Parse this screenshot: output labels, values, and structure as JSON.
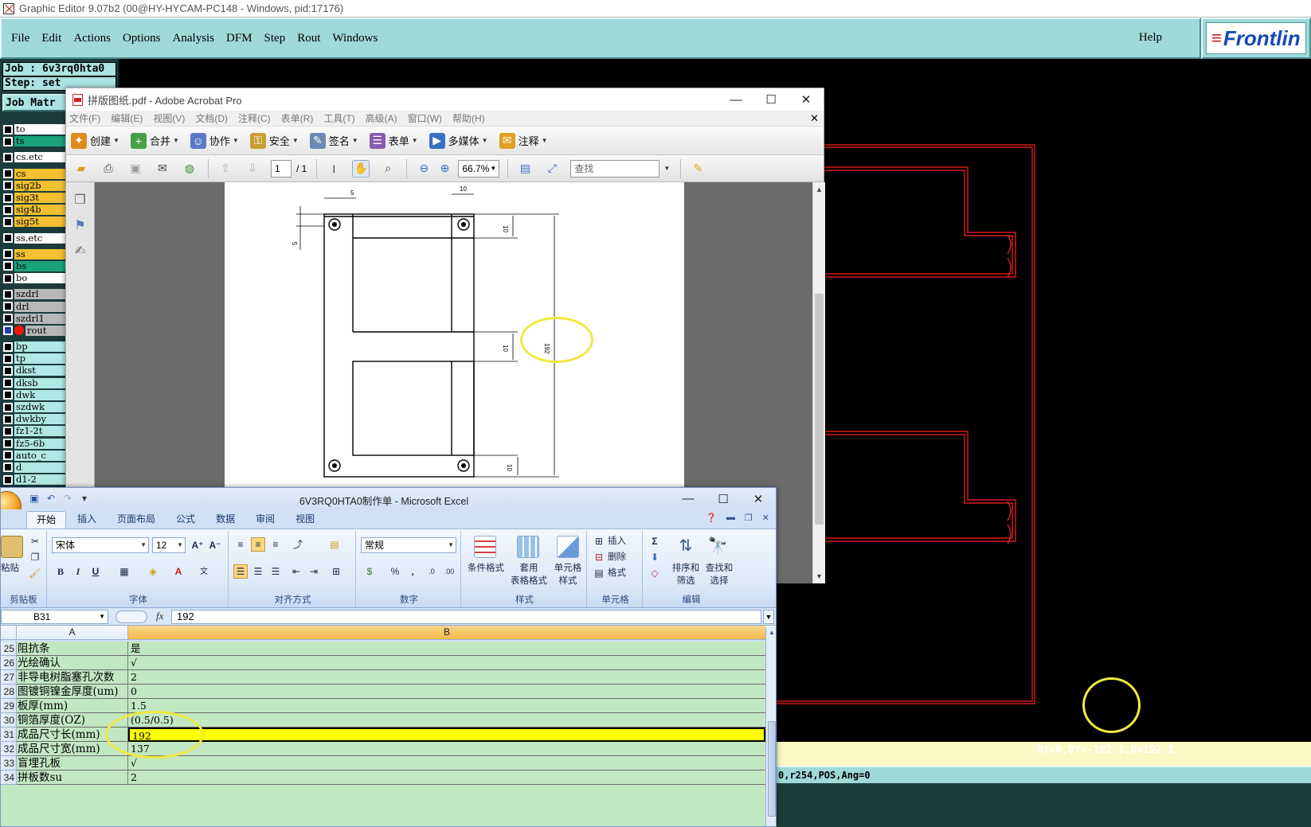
{
  "graphic_editor": {
    "title": "Graphic Editor 9.07b2 (00@HY-HYCAM-PC148 - Windows, pid:17176)",
    "menu": [
      "File",
      "Edit",
      "Actions",
      "Options",
      "Analysis",
      "DFM",
      "Step",
      "Rout",
      "Windows"
    ],
    "help": "Help",
    "logo_text": "Frontlin",
    "job": "Job : 6v3rq0hta0",
    "step": "Step: set",
    "job_matrix": "Job Matr",
    "layers": [
      {
        "name": "to",
        "cls": "ln-board",
        "gap": true,
        "on": false,
        "dot": false
      },
      {
        "name": "ts",
        "cls": "ln-sm",
        "gap": false,
        "on": false,
        "dot": false
      },
      {
        "name": "cs.etc",
        "cls": "ln-board",
        "gap": true,
        "on": false,
        "dot": false
      },
      {
        "name": "cs",
        "cls": "ln-sig",
        "gap": true,
        "on": false,
        "dot": false
      },
      {
        "name": "sig2b",
        "cls": "ln-sig",
        "gap": false,
        "on": false,
        "dot": false
      },
      {
        "name": "sig3t",
        "cls": "ln-sig",
        "gap": false,
        "on": false,
        "dot": false
      },
      {
        "name": "sig4b",
        "cls": "ln-sig",
        "gap": false,
        "on": false,
        "dot": false
      },
      {
        "name": "sig5t",
        "cls": "ln-sig",
        "gap": false,
        "on": false,
        "dot": false
      },
      {
        "name": "ss.etc",
        "cls": "ln-board",
        "gap": true,
        "on": false,
        "dot": false
      },
      {
        "name": "ss",
        "cls": "ln-sig",
        "gap": true,
        "on": false,
        "dot": false
      },
      {
        "name": "bs",
        "cls": "ln-sm",
        "gap": false,
        "on": false,
        "dot": false
      },
      {
        "name": "bo",
        "cls": "ln-board",
        "gap": false,
        "on": false,
        "dot": false
      },
      {
        "name": "szdrl",
        "cls": "ln-drill",
        "gap": true,
        "on": false,
        "dot": false
      },
      {
        "name": "drl",
        "cls": "ln-drill",
        "gap": false,
        "on": false,
        "dot": false
      },
      {
        "name": "szdrl1",
        "cls": "ln-drill",
        "gap": false,
        "on": false,
        "dot": false
      },
      {
        "name": "rout",
        "cls": "ln-drill",
        "gap": false,
        "on": true,
        "dot": true
      },
      {
        "name": "bp",
        "cls": "ln-misc",
        "gap": true,
        "on": false,
        "dot": false
      },
      {
        "name": "tp",
        "cls": "ln-misc",
        "gap": false,
        "on": false,
        "dot": false
      },
      {
        "name": "dkst",
        "cls": "ln-misc",
        "gap": false,
        "on": false,
        "dot": false
      },
      {
        "name": "dksb",
        "cls": "ln-misc",
        "gap": false,
        "on": false,
        "dot": false
      },
      {
        "name": "dwk",
        "cls": "ln-misc",
        "gap": false,
        "on": false,
        "dot": false
      },
      {
        "name": "szdwk",
        "cls": "ln-misc",
        "gap": false,
        "on": false,
        "dot": false
      },
      {
        "name": "dwkby",
        "cls": "ln-misc",
        "gap": false,
        "on": false,
        "dot": false
      },
      {
        "name": "fz1-2t",
        "cls": "ln-misc",
        "gap": false,
        "on": false,
        "dot": false
      },
      {
        "name": "fz5-6b",
        "cls": "ln-misc",
        "gap": false,
        "on": false,
        "dot": false
      },
      {
        "name": "auto_c",
        "cls": "ln-misc",
        "gap": false,
        "on": false,
        "dot": false
      },
      {
        "name": "d",
        "cls": "ln-misc",
        "gap": false,
        "on": false,
        "dot": false
      },
      {
        "name": "d1-2",
        "cls": "ln-misc",
        "gap": false,
        "on": false,
        "dot": false
      }
    ],
    "measure_text": "DX=0,DY=-192.1,D=192.1",
    "coord_text": "0,r254,POS,Ang=0",
    "colors": {
      "outline": "#ff2020",
      "background": "#000000",
      "panel": "#9fd9d8",
      "highlight": "#eeea40"
    }
  },
  "acrobat": {
    "title": "拼版图纸.pdf - Adobe Acrobat Pro",
    "menu": [
      "文件(F)",
      "编辑(E)",
      "视图(V)",
      "文档(D)",
      "注释(C)",
      "表单(R)",
      "工具(T)",
      "高级(A)",
      "窗口(W)",
      "帮助(H)"
    ],
    "tools": [
      {
        "label": "创建",
        "color": "#e08a20",
        "glyph": "✦"
      },
      {
        "label": "合并",
        "color": "#48a048",
        "glyph": "+"
      },
      {
        "label": "协作",
        "color": "#5a7ac8",
        "glyph": "☺"
      },
      {
        "label": "安全",
        "color": "#c8a030",
        "glyph": "⚿"
      },
      {
        "label": "签名",
        "color": "#6a8ab0",
        "glyph": "✎"
      },
      {
        "label": "表单",
        "color": "#8a5ab0",
        "glyph": "☰"
      },
      {
        "label": "多媒体",
        "color": "#3a70c0",
        "glyph": "▶"
      },
      {
        "label": "注释",
        "color": "#e0a020",
        "glyph": "✉"
      }
    ],
    "page_current": "1",
    "page_total": "/ 1",
    "zoom": "66.7%",
    "find_placeholder": "查找",
    "dim_labels": {
      "top": "5",
      "top_right": "10",
      "left": "5",
      "r1": "10",
      "r2": "10",
      "r3": "10",
      "overall": "192"
    }
  },
  "excel": {
    "title": "6V3RQ0HTA0制作单 - Microsoft Excel",
    "tabs": [
      "开始",
      "插入",
      "页面布局",
      "公式",
      "数据",
      "审阅",
      "视图"
    ],
    "ribbon": {
      "clipboard": {
        "paste": "粘贴",
        "label": "剪贴板"
      },
      "font": {
        "name": "宋体",
        "size": "12",
        "bold": "B",
        "italic": "I",
        "underline": "U",
        "label": "字体"
      },
      "alignment": {
        "label": "对齐方式"
      },
      "number": {
        "format": "常规",
        "label": "数字"
      },
      "styles": {
        "cond": "条件格式",
        "table1": "套用",
        "table2": "表格格式",
        "cell1": "单元格",
        "cell2": "样式",
        "label": "样式"
      },
      "cells": {
        "insert": "插入",
        "delete": "删除",
        "format": "格式",
        "label": "单元格"
      },
      "editing": {
        "sort1": "排序和",
        "sort2": "筛选",
        "find1": "查找和",
        "find2": "选择",
        "label": "编辑"
      }
    },
    "name_box": "B31",
    "formula_value": "192",
    "columns": [
      "A",
      "B"
    ],
    "rows": [
      {
        "num": "25",
        "a": "阻抗条",
        "b": "是",
        "selected": false
      },
      {
        "num": "26",
        "a": "光绘确认",
        "b": "√",
        "selected": false
      },
      {
        "num": "27",
        "a": "非导电树脂塞孔次数",
        "b": "2",
        "selected": false
      },
      {
        "num": "28",
        "a": "图镀铜镍金厚度(um)",
        "b": "0",
        "selected": false
      },
      {
        "num": "29",
        "a": "板厚(mm)",
        "b": "1.5",
        "selected": false
      },
      {
        "num": "30",
        "a": "铜箔厚度(OZ)",
        "b": "(0.5/0.5)",
        "selected": false
      },
      {
        "num": "31",
        "a": "成品尺寸长(mm)",
        "b": "192",
        "selected": true
      },
      {
        "num": "32",
        "a": "成品尺寸宽(mm)",
        "b": "137",
        "selected": false
      },
      {
        "num": "33",
        "a": "盲埋孔板",
        "b": "√",
        "selected": false
      },
      {
        "num": "34",
        "a": "拼板数su",
        "b": "2",
        "selected": false
      }
    ]
  }
}
